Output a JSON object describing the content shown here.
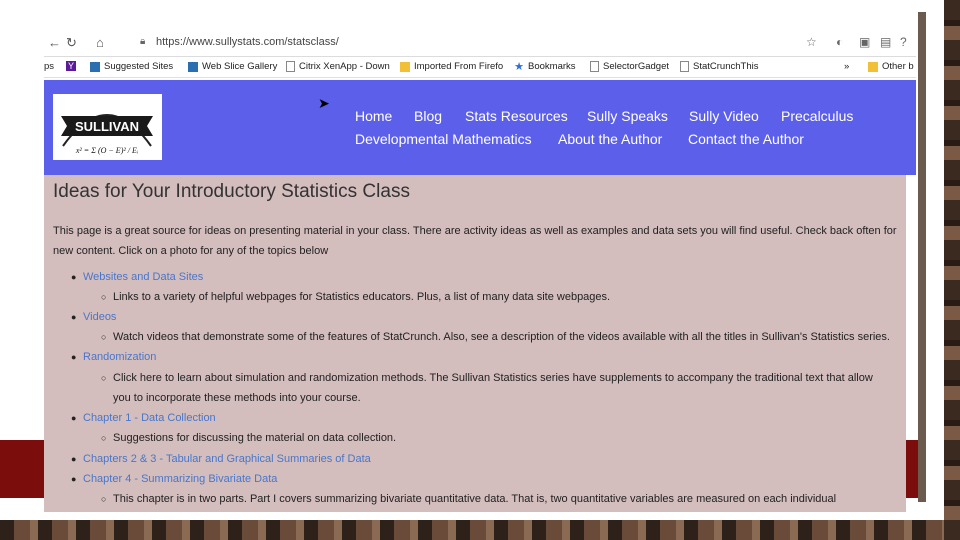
{
  "browser": {
    "url": "https://www.sullystats.com/statsclass/",
    "lock_icon": "lock-icon",
    "bookmarks": [
      {
        "label": "ps",
        "icon": "apps-icon"
      },
      {
        "label": "",
        "icon": "yahoo-icon"
      },
      {
        "label": "Suggested Sites",
        "icon": "bookmark-page-icon"
      },
      {
        "label": "Web Slice Gallery",
        "icon": "bookmark-page-icon"
      },
      {
        "label": "Citrix XenApp - Down",
        "icon": "page-icon"
      },
      {
        "label": "Imported From Firefo",
        "icon": "folder-icon"
      },
      {
        "label": "Bookmarks",
        "icon": "star-icon"
      },
      {
        "label": "SelectorGadget",
        "icon": "page-icon"
      },
      {
        "label": "StatCrunchThis",
        "icon": "page-icon"
      },
      {
        "label": "»",
        "icon": ""
      },
      {
        "label": "Other b",
        "icon": "folder-icon"
      }
    ]
  },
  "header": {
    "logo_text": "SULLIVAN",
    "logo_formula": "x² = Σ (O − E)² / Eᵢ",
    "nav_row1": [
      "Home",
      "Blog",
      "Stats Resources",
      "Sully Speaks",
      "Sully Video",
      "Precalculus"
    ],
    "nav_row2": [
      "Developmental Mathematics",
      "About the Author",
      "Contact the Author"
    ]
  },
  "content": {
    "title": "Ideas for Your Introductory Statistics Class",
    "intro": "This page is a great source for ideas on presenting material in your class.  There are activity ideas as well as examples and data sets you will find useful.  Check back often for new content.  Click on a photo for any of the topics below",
    "topics": [
      {
        "title": "Websites and Data Sites",
        "desc": [
          "Links to a variety of helpful webpages for Statistics educators.  Plus, a list of many data site webpages."
        ]
      },
      {
        "title": "Videos",
        "desc": [
          "Watch videos that demonstrate some of the features of StatCrunch.  Also, see a description of the videos available with all the titles in Sullivan's Statistics series."
        ]
      },
      {
        "title": "Randomization",
        "desc": [
          "Click here to learn about simulation and randomization methods.  The Sullivan Statistics series have supplements to accompany the traditional text that allow",
          "you to incorporate these methods into your course."
        ]
      },
      {
        "title": "Chapter 1 - Data Collection",
        "desc": [
          "Suggestions for discussing the material on data collection."
        ]
      },
      {
        "title": "Chapters 2 & 3 - Tabular and Graphical Summaries of Data",
        "desc": []
      },
      {
        "title": "Chapter 4 - Summarizing Bivariate Data",
        "desc": [
          "This chapter is in two parts.  Part I covers summarizing bivariate quantitative data.  That is, two quantitative variables are measured on each individual"
        ]
      }
    ]
  },
  "colors": {
    "header_bg": "#5b5fe9",
    "content_bg": "#d3bdbd",
    "link": "#4a76c9",
    "slide_accent": "#7b0d0d"
  }
}
